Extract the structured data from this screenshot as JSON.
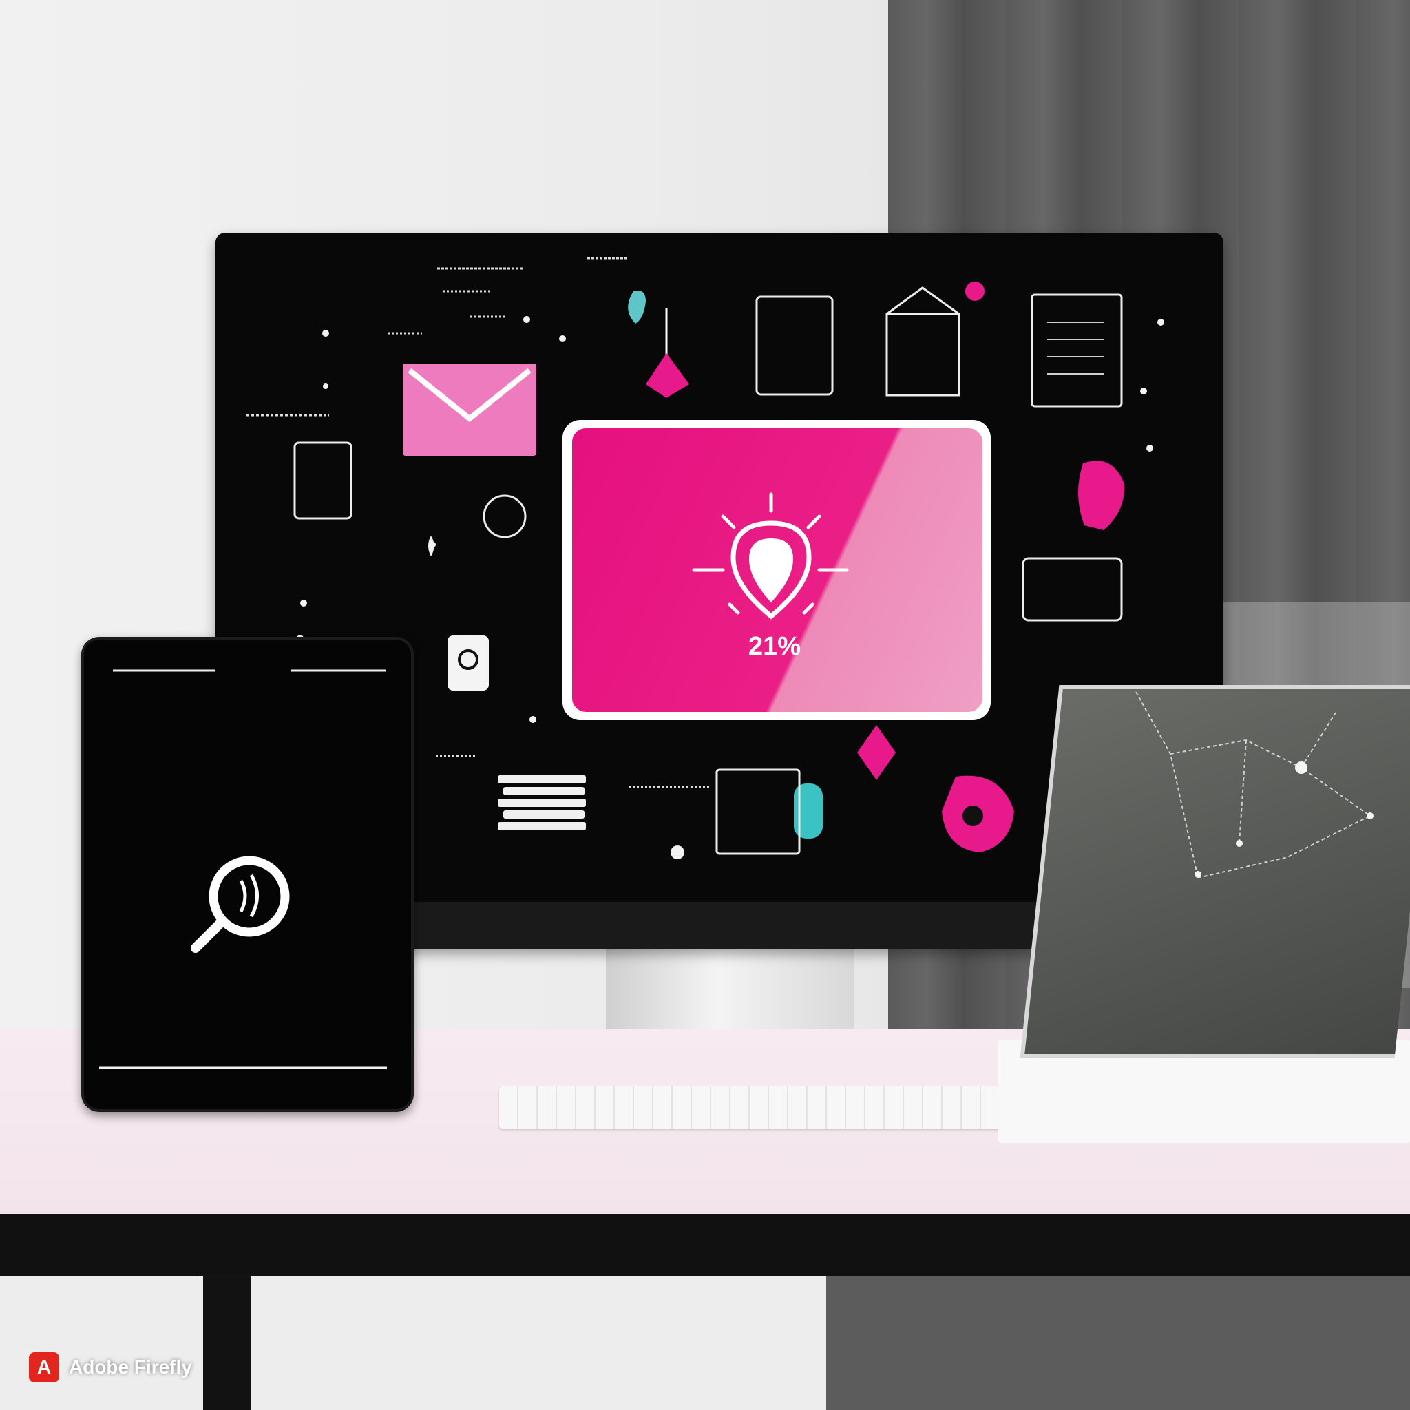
{
  "monitor_card": {
    "percentage": "21%"
  },
  "watermark": {
    "logo_letter": "A",
    "text": "Adobe Firefly"
  },
  "colors": {
    "accent_pink": "#e5107f",
    "accent_teal": "#3bc2c2",
    "screen_black": "#080808"
  }
}
